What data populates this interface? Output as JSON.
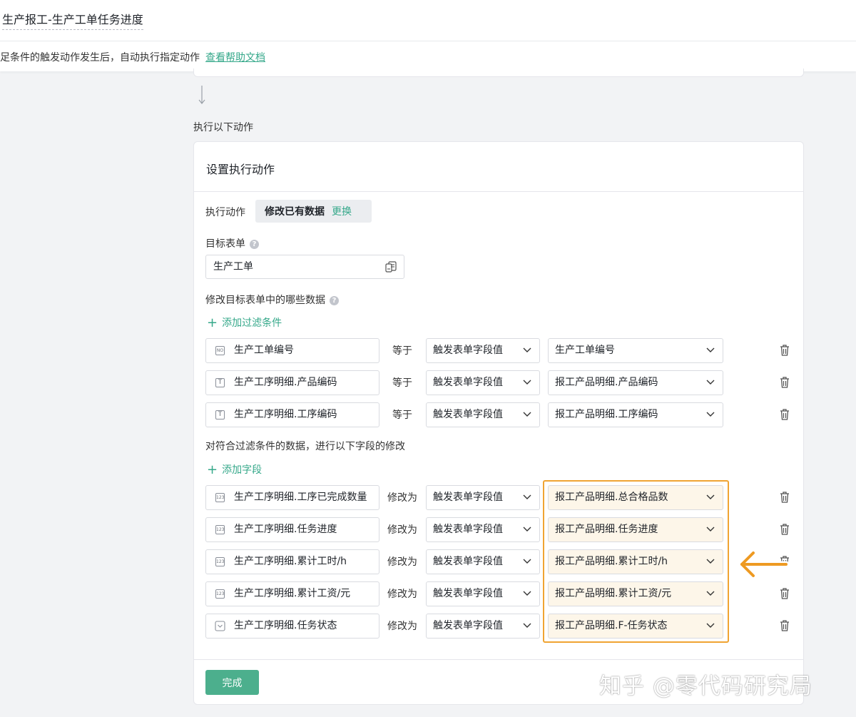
{
  "header": {
    "title": "生产报工-生产工单任务进度"
  },
  "subbar": {
    "description": "足条件的触发动作发生后，自动执行指定动作",
    "help_link": "查看帮助文档"
  },
  "section": {
    "label": "执行以下动作"
  },
  "card": {
    "title": "设置执行动作",
    "action_label": "执行动作",
    "action_value": "修改已有数据",
    "action_change": "更换",
    "target_label": "目标表单",
    "target_value": "生产工单",
    "which_label": "修改目标表单中的哪些数据",
    "add_filter": "添加过滤条件",
    "filters": [
      {
        "icon": "NO",
        "field": "生产工单编号",
        "op": "等于",
        "source": "触发表单字段值",
        "value": "生产工单编号"
      },
      {
        "icon": "T",
        "field": "生产工序明细.产品编码",
        "op": "等于",
        "source": "触发表单字段值",
        "value": "报工产品明细.产品编码"
      },
      {
        "icon": "T",
        "field": "生产工序明细.工序编码",
        "op": "等于",
        "source": "触发表单字段值",
        "value": "报工产品明细.工序编码"
      }
    ],
    "modify_label": "对符合过滤条件的数据，进行以下字段的修改",
    "add_field": "添加字段",
    "modifications": [
      {
        "icon": "123",
        "field": "生产工序明细.工序已完成数量",
        "op": "修改为",
        "source": "触发表单字段值",
        "value": "报工产品明细.总合格品数"
      },
      {
        "icon": "123",
        "field": "生产工序明细.任务进度",
        "op": "修改为",
        "source": "触发表单字段值",
        "value": "报工产品明细.任务进度"
      },
      {
        "icon": "123",
        "field": "生产工序明细.累计工时/h",
        "op": "修改为",
        "source": "触发表单字段值",
        "value": "报工产品明细.累计工时/h"
      },
      {
        "icon": "123",
        "field": "生产工序明细.累计工资/元",
        "op": "修改为",
        "source": "触发表单字段值",
        "value": "报工产品明细.累计工资/元"
      },
      {
        "icon": "select",
        "field": "生产工序明细.任务状态",
        "op": "修改为",
        "source": "触发表单字段值",
        "value": "报工产品明细.F-任务状态"
      }
    ],
    "done_button": "完成"
  },
  "colors": {
    "accent": "#35a88a",
    "button": "#4caf8d",
    "highlight": "#f0a432",
    "highlight_fill": "#fdf6e9"
  },
  "watermark": "知乎 @零代码研究局"
}
